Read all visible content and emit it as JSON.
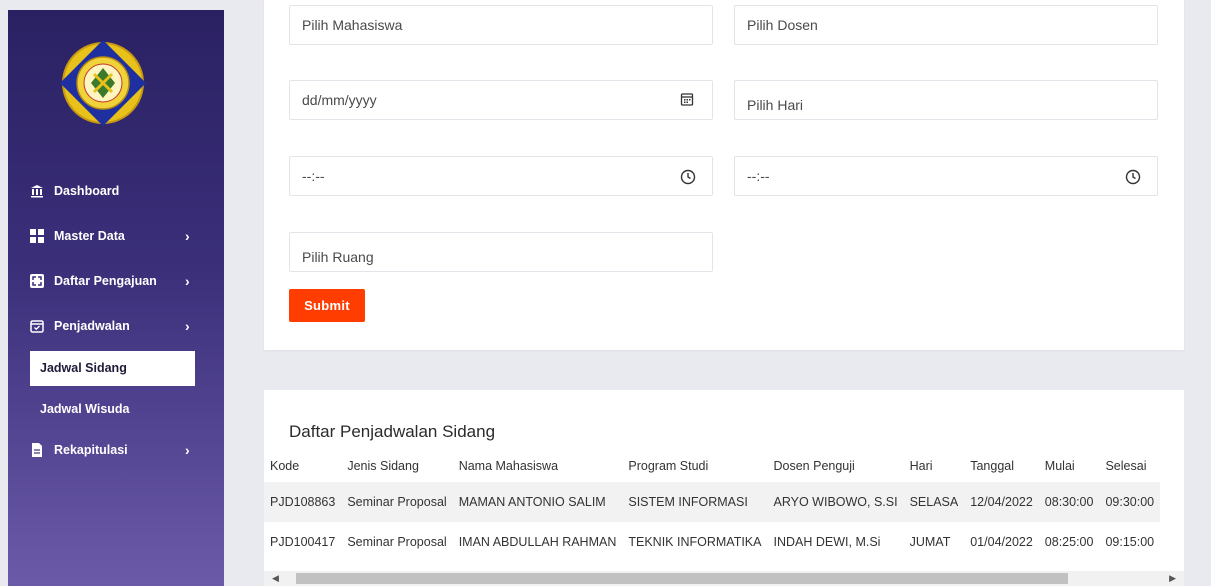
{
  "sidebar": {
    "nav": [
      {
        "label": "Dashboard",
        "icon": "institution-icon",
        "has_children": false
      },
      {
        "label": "Master Data",
        "icon": "grid-icon",
        "has_children": true
      },
      {
        "label": "Daftar Pengajuan",
        "icon": "expand-icon",
        "has_children": true
      },
      {
        "label": "Penjadwalan",
        "icon": "calendar-check-icon",
        "has_children": true
      },
      {
        "label": "Rekapitulasi",
        "icon": "file-icon",
        "has_children": true
      }
    ],
    "sub_items": [
      {
        "label": "Jadwal Sidang",
        "active": true
      },
      {
        "label": "Jadwal Wisuda",
        "active": false
      }
    ],
    "chevron": "›"
  },
  "form": {
    "mahasiswa_placeholder": "Pilih Mahasiswa",
    "dosen_placeholder": "Pilih Dosen",
    "date_placeholder": "dd/mm/yyyy",
    "hari_placeholder": "Pilih Hari",
    "time_start_placeholder": "--:--",
    "time_end_placeholder": "--:--",
    "ruang_placeholder": "Pilih Ruang",
    "submit_label": "Submit",
    "accent": "#ff3d00"
  },
  "table": {
    "title": "Daftar Penjadwalan Sidang",
    "columns": [
      "Kode",
      "Jenis Sidang",
      "Nama Mahasiswa",
      "Program Studi",
      "Dosen Penguji",
      "Hari",
      "Tanggal",
      "Mulai",
      "Selesai"
    ],
    "rows": [
      [
        "PJD108863",
        "Seminar Proposal",
        "MAMAN ANTONIO SALIM",
        "SISTEM INFORMASI",
        "ARYO WIBOWO, S.SI",
        "SELASA",
        "12/04/2022",
        "08:30:00",
        "09:30:00"
      ],
      [
        "PJD100417",
        "Seminar Proposal",
        "IMAN ABDULLAH RAHMAN",
        "TEKNIK INFORMATIKA",
        "INDAH DEWI, M.Si",
        "JUMAT",
        "01/04/2022",
        "08:25:00",
        "09:15:00"
      ]
    ]
  },
  "colors": {
    "sidebar_top": "#2a2163",
    "sidebar_bottom": "#6b5aa8",
    "page_bg": "#e9eaef"
  }
}
